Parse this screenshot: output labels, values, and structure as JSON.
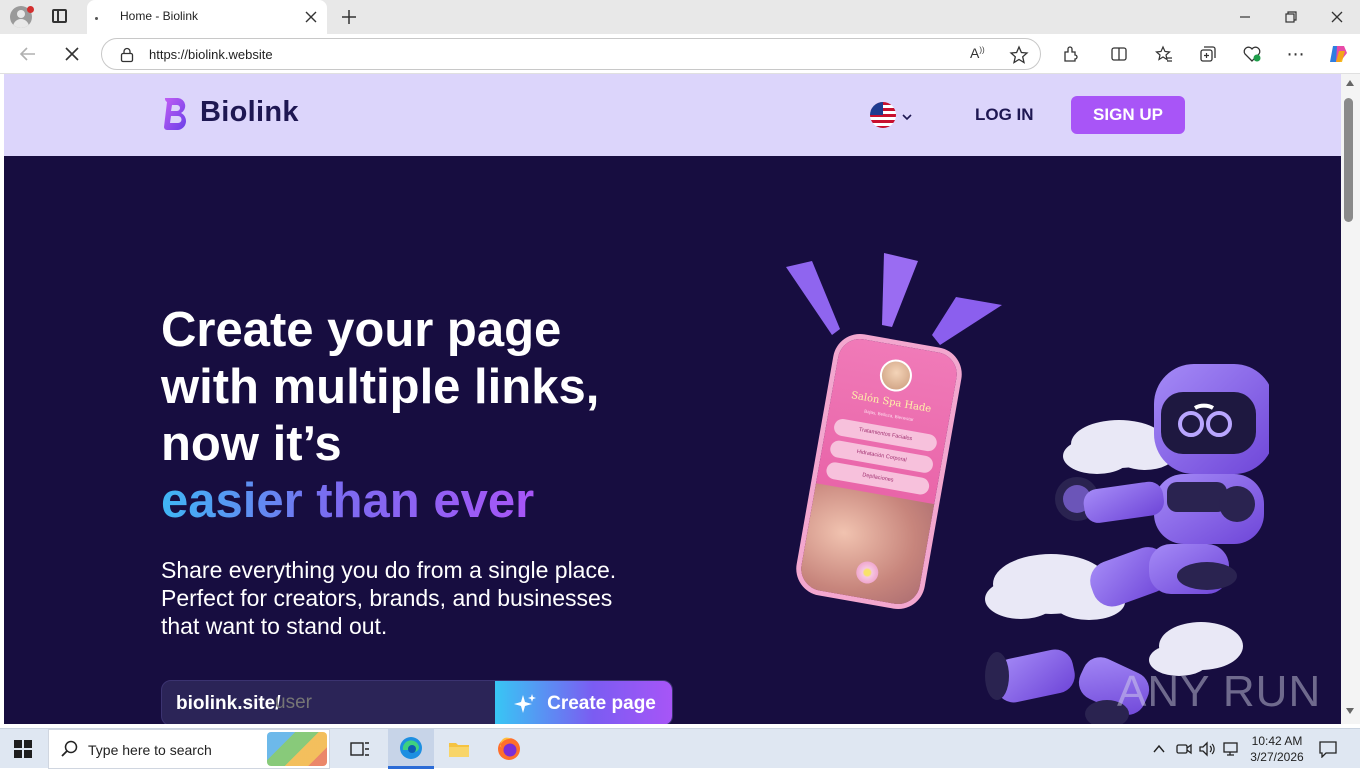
{
  "browser": {
    "tab_title": "Home - Biolink",
    "url": "https://biolink.website"
  },
  "header": {
    "logo_text": "Biolink",
    "login_label": "LOG IN",
    "signup_label": "SIGN UP",
    "accent": "#a855f7"
  },
  "hero": {
    "title_line1": "Create your page",
    "title_line2": "with multiple links,",
    "title_line3": "now it’s",
    "title_highlight": "easier than ever",
    "description_line1": "Share everything you do from a single place.",
    "description_line2": "Perfect for creators, brands, and businesses",
    "description_line3": "that want to stand out.",
    "url_prefix": "biolink.site/",
    "url_placeholder": "user",
    "cta_label": "Create page"
  },
  "phone": {
    "name": "Salón Spa Hade",
    "tagline": "Bajas, Belleza, Bienestar",
    "links": [
      "Tratamientos Faciales",
      "Hidratación Corporal",
      "Depilaciones"
    ]
  },
  "watermark": "ANY RUN",
  "taskbar": {
    "search_placeholder": "Type here to search",
    "time": "10:42 AM",
    "date": "3/27/2026"
  }
}
